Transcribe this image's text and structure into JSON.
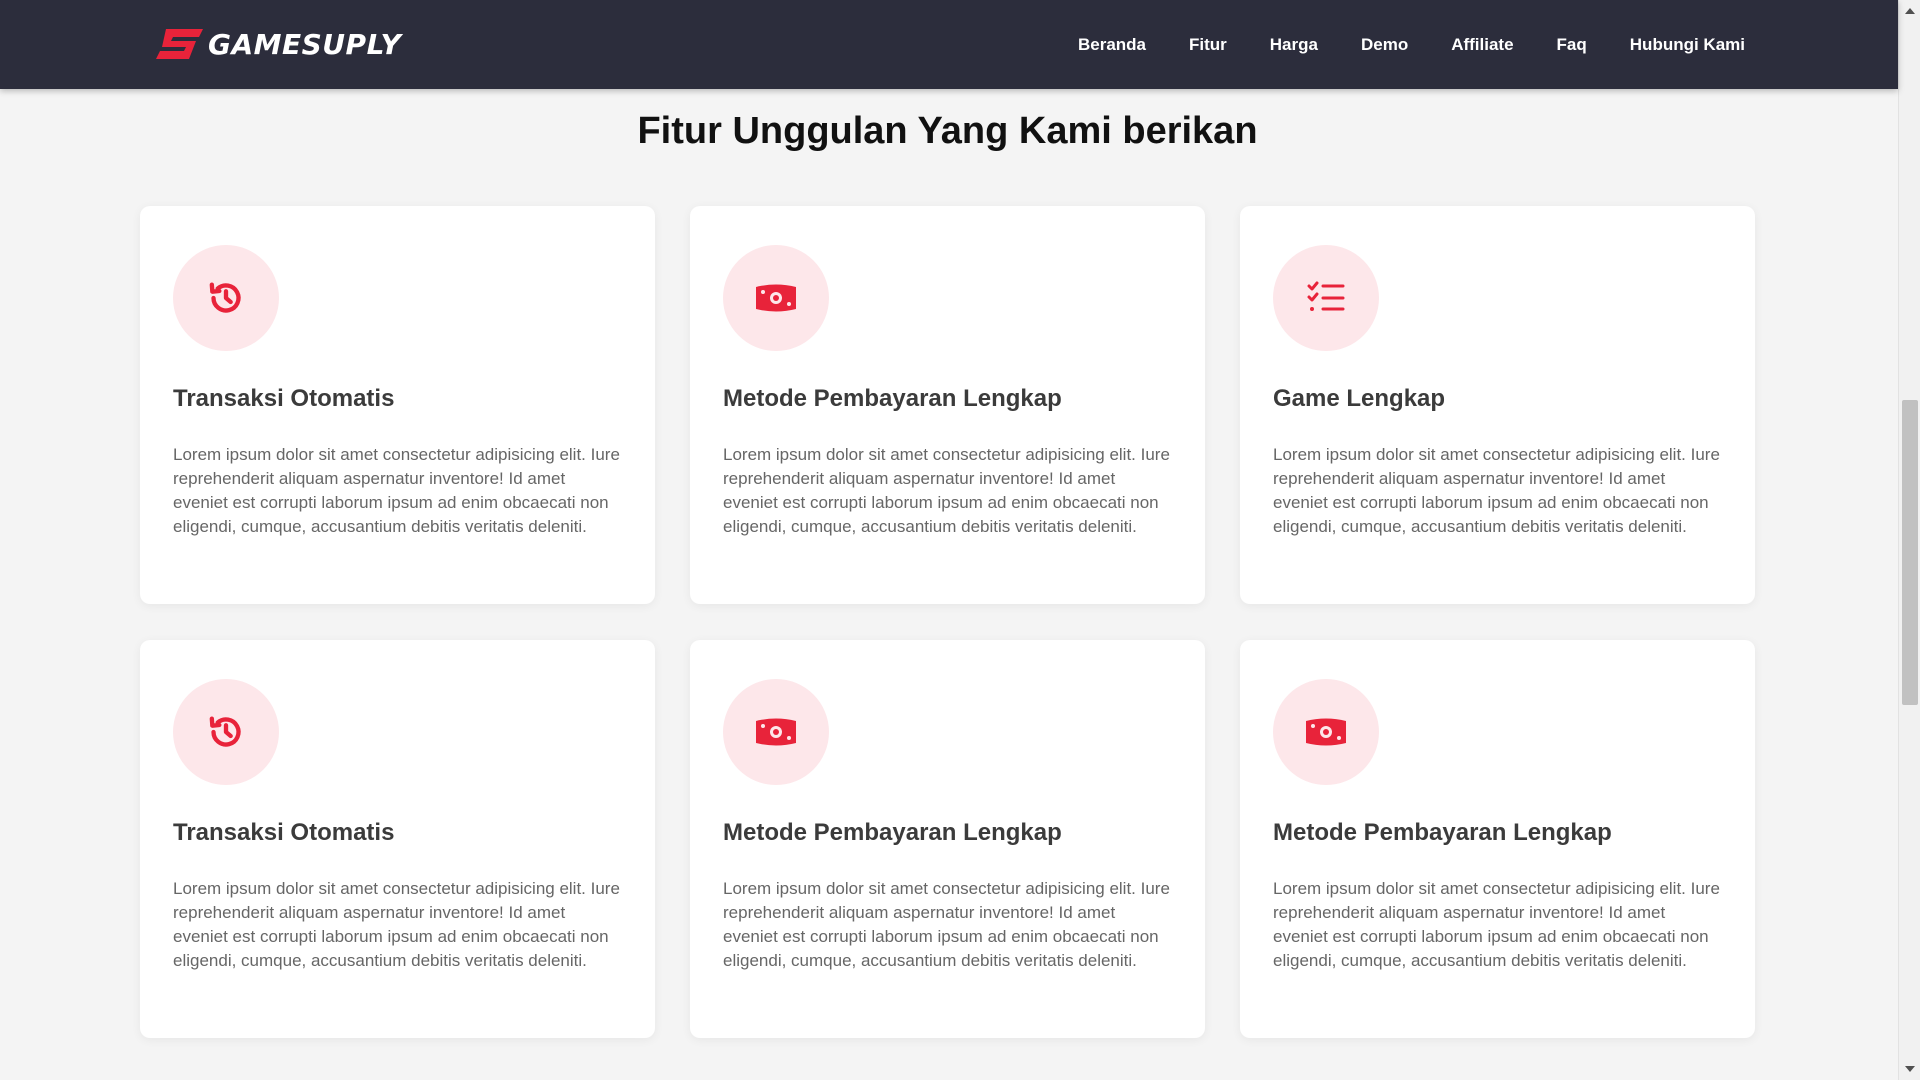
{
  "brand": {
    "name": "GAMESUPLY",
    "logo_color": "#e8233a"
  },
  "nav": {
    "items": [
      "Beranda",
      "Fitur",
      "Harga",
      "Demo",
      "Affiliate",
      "Faq",
      "Hubungi Kami"
    ]
  },
  "section": {
    "title": "Fitur Unggulan Yang Kami berikan"
  },
  "colors": {
    "navbar_bg": "#2c2d3c",
    "accent": "#e8233a",
    "icon_bg": "#fde7ea",
    "page_bg": "#f4f4f4"
  },
  "cards": [
    {
      "icon": "history-icon",
      "title": "Transaksi Otomatis",
      "description": "Lorem ipsum dolor sit amet consectetur adipisicing elit. Iure reprehenderit aliquam aspernatur inventore! Id amet eveniet est corrupti laborum ipsum ad enim obcaecati non eligendi, cumque, accusantium debitis veritatis deleniti."
    },
    {
      "icon": "money-bill-icon",
      "title": "Metode Pembayaran Lengkap",
      "description": "Lorem ipsum dolor sit amet consectetur adipisicing elit. Iure reprehenderit aliquam aspernatur inventore! Id amet eveniet est corrupti laborum ipsum ad enim obcaecati non eligendi, cumque, accusantium debitis veritatis deleniti."
    },
    {
      "icon": "list-check-icon",
      "title": "Game Lengkap",
      "description": "Lorem ipsum dolor sit amet consectetur adipisicing elit. Iure reprehenderit aliquam aspernatur inventore! Id amet eveniet est corrupti laborum ipsum ad enim obcaecati non eligendi, cumque, accusantium debitis veritatis deleniti."
    },
    {
      "icon": "history-icon",
      "title": "Transaksi Otomatis",
      "description": "Lorem ipsum dolor sit amet consectetur adipisicing elit. Iure reprehenderit aliquam aspernatur inventore! Id amet eveniet est corrupti laborum ipsum ad enim obcaecati non eligendi, cumque, accusantium debitis veritatis deleniti."
    },
    {
      "icon": "money-bill-icon",
      "title": "Metode Pembayaran Lengkap",
      "description": "Lorem ipsum dolor sit amet consectetur adipisicing elit. Iure reprehenderit aliquam aspernatur inventore! Id amet eveniet est corrupti laborum ipsum ad enim obcaecati non eligendi, cumque, accusantium debitis veritatis deleniti."
    },
    {
      "icon": "money-bill-icon",
      "title": "Metode Pembayaran Lengkap",
      "description": "Lorem ipsum dolor sit amet consectetur adipisicing elit. Iure reprehenderit aliquam aspernatur inventore! Id amet eveniet est corrupti laborum ipsum ad enim obcaecati non eligendi, cumque, accusantium debitis veritatis deleniti."
    }
  ]
}
